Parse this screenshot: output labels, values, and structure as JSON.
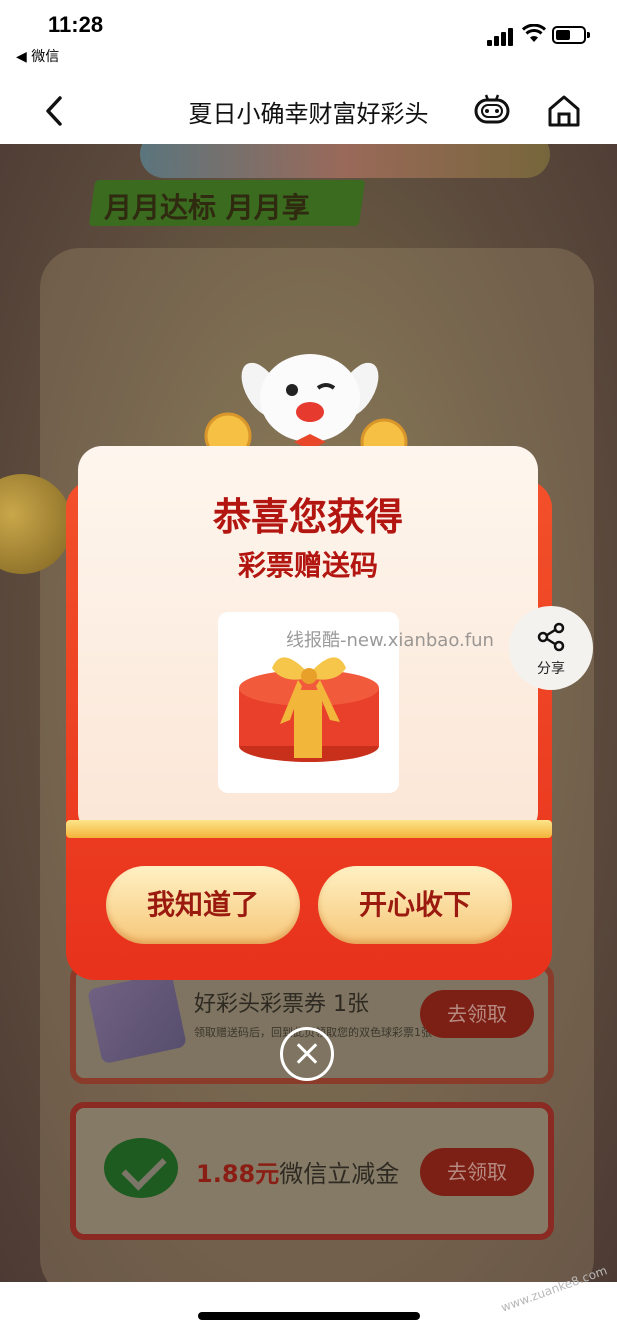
{
  "status_bar": {
    "time": "11:28",
    "back_app": "◀ 微信"
  },
  "nav": {
    "title": "夏日小确幸财富好彩头"
  },
  "background": {
    "slogan": "月月达标 月月享",
    "ticket_row": {
      "label": "好彩头彩票券 1张",
      "sublabel": "领取赠送码后，回到此页领取您的双色球彩票1张",
      "button": "去领取"
    },
    "coupon_row": {
      "amount": "1.88元",
      "label": "微信立减金",
      "button": "去领取"
    }
  },
  "popup": {
    "title": "恭喜您获得",
    "subtitle": "彩票赠送码",
    "prize_icon": "gift-box-icon",
    "buttons": {
      "left": "我知道了",
      "right": "开心收下"
    }
  },
  "share": {
    "label": "分享"
  },
  "watermark": "线报酷-new.xianbao.fun",
  "watermark_corner": "www.zuanke8.com",
  "colors": {
    "popup_red": "#e8321c",
    "title_red": "#b31610",
    "button_gold": "#f6c779"
  }
}
